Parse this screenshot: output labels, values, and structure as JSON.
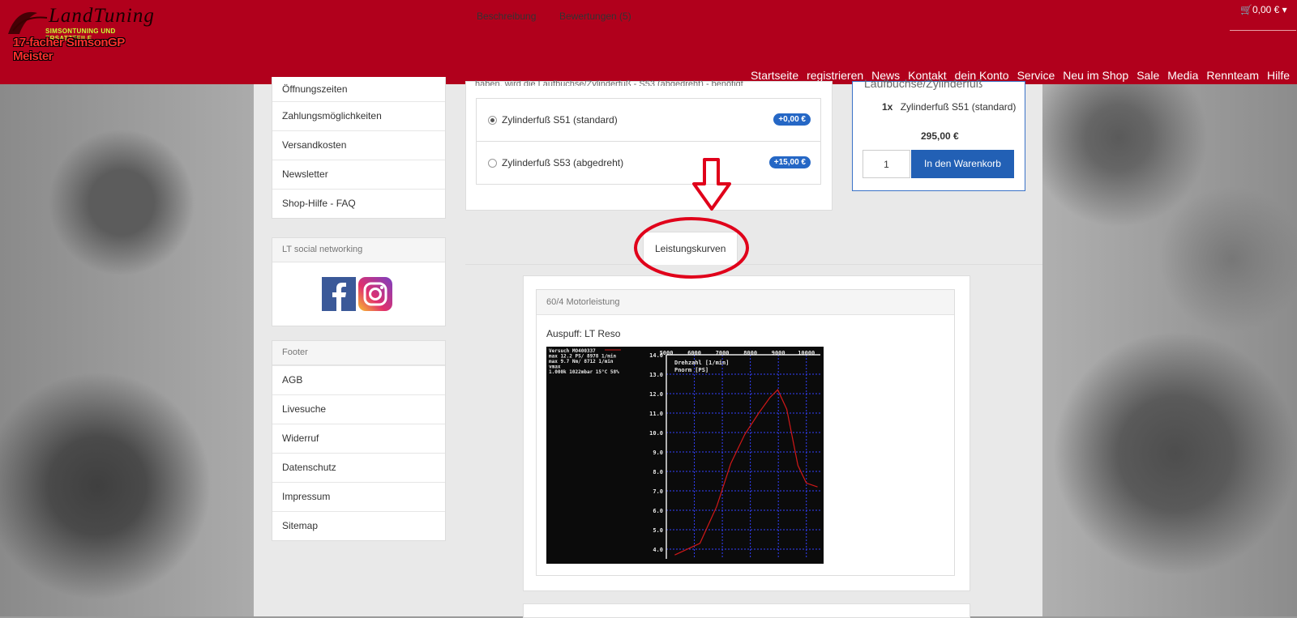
{
  "header": {
    "logo": {
      "script": "LandTuning",
      "tagline": "SIMSONTUNING UND ERSATZTEILE",
      "title": "17-facher SimsonGP Meister"
    },
    "cart_total": "0,00 €",
    "nav": [
      "Startseite",
      "registrieren",
      "News",
      "Kontakt",
      "dein Konto",
      "Service",
      "Neu im Shop",
      "Sale",
      "Media",
      "Rennteam",
      "Hilfe"
    ]
  },
  "sidebar": {
    "info_items": [
      "Öffnungszeiten",
      "Zahlungsmöglichkeiten",
      "Versandkosten",
      "Newsletter",
      "Shop-Hilfe - FAQ"
    ],
    "social": {
      "title": "LT social networking"
    },
    "footer": {
      "title": "Footer",
      "items": [
        "AGB",
        "Livesuche",
        "Widerruf",
        "Datenschutz",
        "Impressum",
        "Sitemap"
      ]
    }
  },
  "product": {
    "options_cutoff_text": "haben, wird die Laufbuchse/Zylinderfuß - S53 (abgedreht) - benötigt",
    "options": [
      {
        "label": "Zylinderfuß S51 (standard)",
        "price": "+0,00 €",
        "selected": true
      },
      {
        "label": "Zylinderfuß S53 (abgedreht)",
        "price": "+15,00 €",
        "selected": false
      }
    ]
  },
  "basket": {
    "header_cutoff": "Laufbuchse/Zylinderfuß",
    "qty_prefix": "1x",
    "item": "Zylinderfuß S51 (standard)",
    "price": "295,00 €",
    "quantity": "1",
    "add_button": "In den Warenkorb"
  },
  "tabs": [
    {
      "label": "Beschreibung",
      "active": false
    },
    {
      "label": "Bewertungen (5)",
      "active": false
    },
    {
      "label": "Leistungskurven",
      "active": true
    }
  ],
  "panel": {
    "title": "60/4 Motorleistung",
    "subtitle": "Auspuff: LT Reso"
  },
  "dyno_chart": {
    "header_lines": [
      "Versuch MO400337",
      "max    12.2 PS/  8978 1/min",
      "max     9.7 Nm/  8712 1/min",
      "vmax",
      "1.000k 1022mbar 15°C 58%"
    ],
    "x_label": "Drehzahl [1/min]",
    "y_label": "Pnorm [PS]",
    "x_ticks": [
      "5000",
      "6000",
      "7000",
      "8000",
      "9000",
      "10000"
    ],
    "y_ticks": [
      "14.0",
      "13.0",
      "12.0",
      "11.0",
      "10.0",
      "9.0",
      "8.0",
      "7.0",
      "6.0",
      "5.0",
      "4.0"
    ],
    "colors": {
      "background": "#0b0b0b",
      "grid": "#3340ff",
      "curve": "#d01818",
      "text": "#e8e8e8"
    }
  },
  "chart_data": {
    "type": "line",
    "xlabel": "Drehzahl [1/min]",
    "ylabel": "Pnorm [PS]",
    "xlim": [
      5000,
      10500
    ],
    "ylim": [
      3.5,
      14
    ],
    "series": [
      {
        "x": [
          5300,
          6200,
          6800,
          7300,
          7800,
          8300,
          8700,
          8978,
          9300,
          9700,
          10000,
          10400
        ],
        "values": [
          3.7,
          4.3,
          6.2,
          8.4,
          9.9,
          11.0,
          11.8,
          12.2,
          11.2,
          8.3,
          7.4,
          7.2
        ]
      }
    ]
  },
  "annotations": {
    "arrow": "down-arrow",
    "circle": "highlight-circle",
    "color": "#e0001a"
  }
}
